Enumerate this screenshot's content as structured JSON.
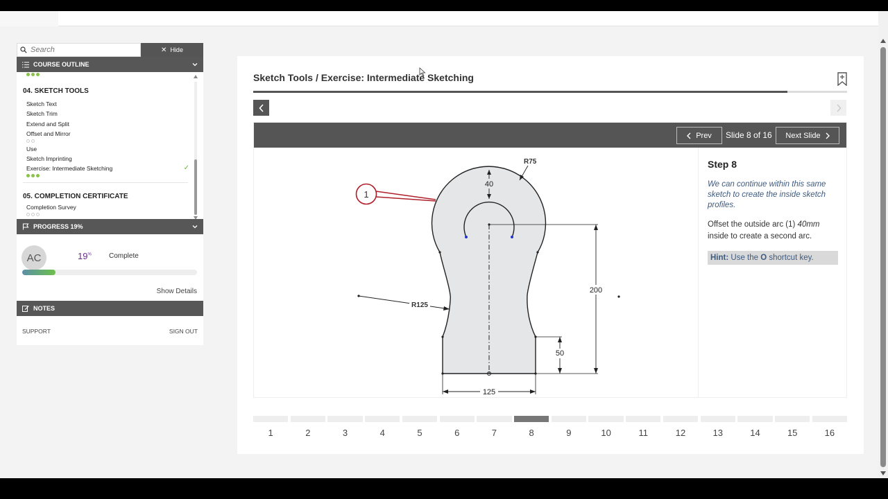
{
  "sidebar": {
    "search_placeholder": "Search",
    "hide_label": "Hide",
    "outline_title": "COURSE OUTLINE",
    "sections": [
      {
        "title": "04. SKETCH TOOLS",
        "items": [
          "Sketch Text",
          "Sketch Trim",
          "Extend and Split",
          "Offset and Mirror",
          "Use",
          "Sketch Imprinting",
          "Exercise: Intermediate Sketching"
        ]
      },
      {
        "title": "05. COMPLETION CERTIFICATE",
        "items": [
          "Completion Survey"
        ]
      }
    ],
    "progress_title": "PROGRESS 19%",
    "avatar_initials": "AC",
    "progress_value": "19",
    "progress_unit": "%",
    "progress_fraction": 0.19,
    "complete_label": "Complete",
    "show_details": "Show Details",
    "notes_title": "NOTES",
    "support": "SUPPORT",
    "sign_out": "SIGN OUT"
  },
  "main": {
    "title": "Sketch Tools / Exercise: Intermediate Sketching",
    "prev_label": "Prev",
    "slide_counter": "Slide 8 of 16",
    "next_label": "Next Slide",
    "current_slide": 8,
    "slides": [
      "1",
      "2",
      "3",
      "4",
      "5",
      "6",
      "7",
      "8",
      "9",
      "10",
      "11",
      "12",
      "13",
      "14",
      "15",
      "16"
    ],
    "step": {
      "title": "Step 8",
      "intro": "We can continue within this same sketch to create the inside sketch profiles.",
      "body_pre": "Offset the outside arc (1) ",
      "body_em": "40mm",
      "body_post": " inside to create a second arc.",
      "hint_label": "Hint:",
      "hint_pre": " Use the ",
      "hint_key": "O",
      "hint_post": " shortcut key."
    },
    "drawing": {
      "callout": "1",
      "r75": "R75",
      "d40": "40",
      "d200": "200",
      "r125": "R125",
      "d50": "50",
      "d125": "125"
    }
  },
  "colors": {
    "accent_dark": "#555555",
    "progress_purple": "#6a2c91",
    "check_green": "#6cb33f",
    "callout_red": "#b0202a"
  }
}
